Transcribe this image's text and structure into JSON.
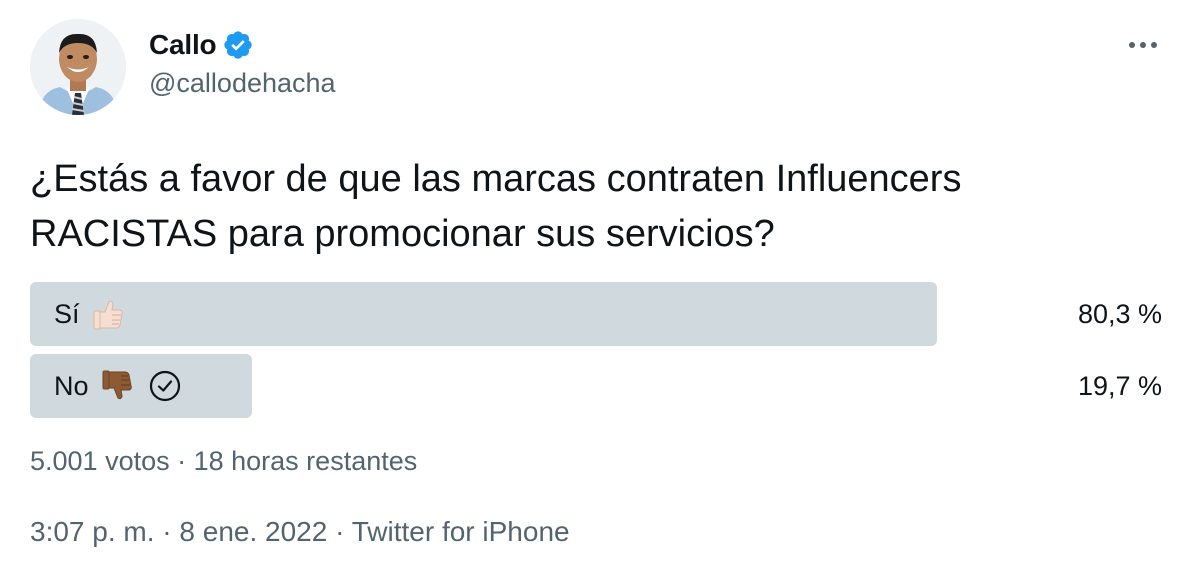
{
  "author": {
    "display_name": "Callo",
    "handle": "@callodehacha",
    "verified": true
  },
  "tweet": {
    "text_line1": "¿Estás a favor de que las marcas contraten Influencers",
    "text_line2": "RACISTAS para promocionar sus servicios?"
  },
  "poll": {
    "options": [
      {
        "label": "Sí",
        "emoji": "thumbs-up-icon",
        "percent_label": "80,3 %",
        "percent": 80.3,
        "selected": false
      },
      {
        "label": "No",
        "emoji": "thumbs-down-icon",
        "percent_label": "19,7 %",
        "percent": 19.7,
        "selected": true
      }
    ],
    "votes": "5.001 votos",
    "separator": " · ",
    "time_left": "18 horas restantes"
  },
  "meta": {
    "time": "3:07 p. m.",
    "date": "8 ene. 2022",
    "source": "Twitter for iPhone",
    "separator": " · "
  },
  "colors": {
    "verified_blue": "#1d9bf0",
    "poll_bar": "#cfd9de",
    "secondary_text": "#536471"
  }
}
